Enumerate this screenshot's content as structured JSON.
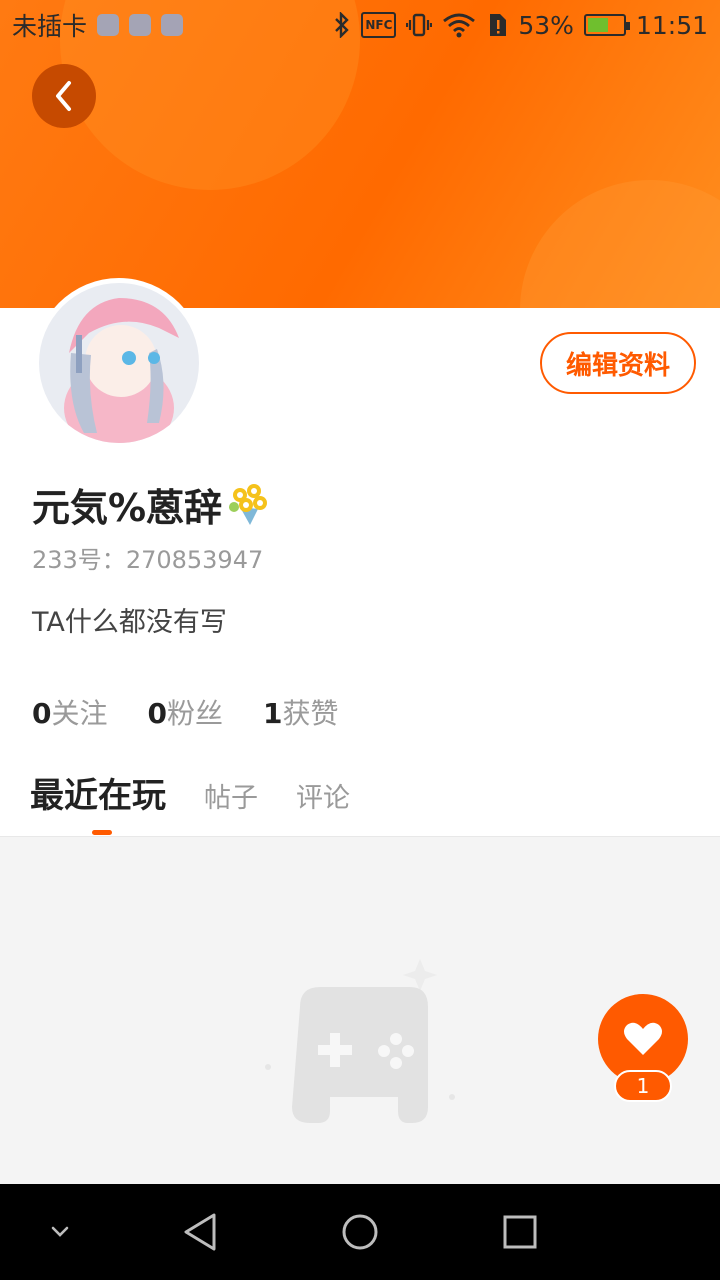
{
  "status_bar": {
    "carrier": "未插卡",
    "nfc_label": "NFC",
    "battery_percent": "53%",
    "battery_level": 0.53,
    "time": "11:51"
  },
  "profile": {
    "nickname": "元気%蒽辞",
    "uid_label": "233号：",
    "uid_value": "270853947",
    "bio": "TA什么都没有写",
    "edit_button_label": "编辑资料"
  },
  "stats": [
    {
      "value": "0",
      "label": "关注"
    },
    {
      "value": "0",
      "label": "粉丝"
    },
    {
      "value": "1",
      "label": "获赞"
    }
  ],
  "tabs": [
    {
      "label": "最近在玩",
      "active": true
    },
    {
      "label": "帖子",
      "active": false
    },
    {
      "label": "评论",
      "active": false
    }
  ],
  "like_badge": {
    "count": "1"
  },
  "colors": {
    "accent": "#ff5a00",
    "banner": "#ff7a12"
  }
}
